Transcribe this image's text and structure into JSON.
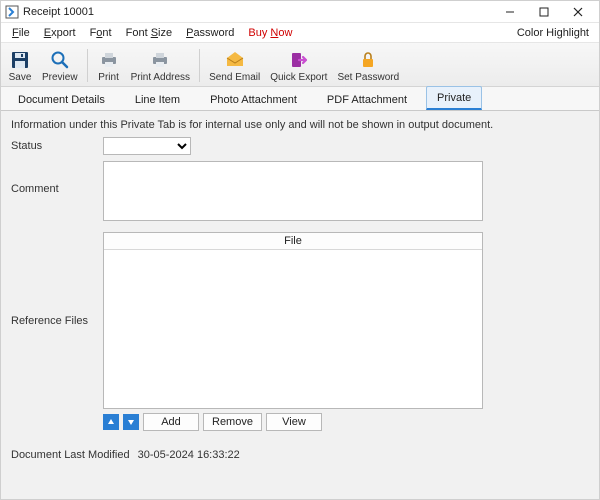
{
  "window": {
    "title": "Receipt 10001"
  },
  "menubar": {
    "items": [
      {
        "pre": "",
        "u": "F",
        "post": "ile"
      },
      {
        "pre": "",
        "u": "E",
        "post": "xport"
      },
      {
        "pre": "F",
        "u": "o",
        "post": "nt"
      },
      {
        "pre": "Font ",
        "u": "S",
        "post": "ize"
      },
      {
        "pre": "",
        "u": "P",
        "post": "assword"
      },
      {
        "pre": "Buy ",
        "u": "N",
        "post": "ow"
      }
    ],
    "color_highlight": "Color Highlight"
  },
  "toolbar": {
    "save": "Save",
    "preview": "Preview",
    "print": "Print",
    "print_address": "Print Address",
    "send_email": "Send Email",
    "quick_export": "Quick Export",
    "set_password": "Set Password"
  },
  "tabs": [
    {
      "label": "Document Details",
      "active": false
    },
    {
      "label": "Line Item",
      "active": false
    },
    {
      "label": "Photo Attachment",
      "active": false
    },
    {
      "label": "PDF Attachment",
      "active": false
    },
    {
      "label": "Private",
      "active": true
    }
  ],
  "private_tab": {
    "info_text": "Information under this Private Tab is for internal use only and will not be shown in output document.",
    "status_label": "Status",
    "status_value": "",
    "comment_label": "Comment",
    "comment_value": "",
    "ref_label": "Reference Files",
    "file_header": "File",
    "add": "Add",
    "remove": "Remove",
    "view": "View"
  },
  "footer": {
    "label": "Document Last Modified",
    "value": "30-05-2024 16:33:22"
  }
}
